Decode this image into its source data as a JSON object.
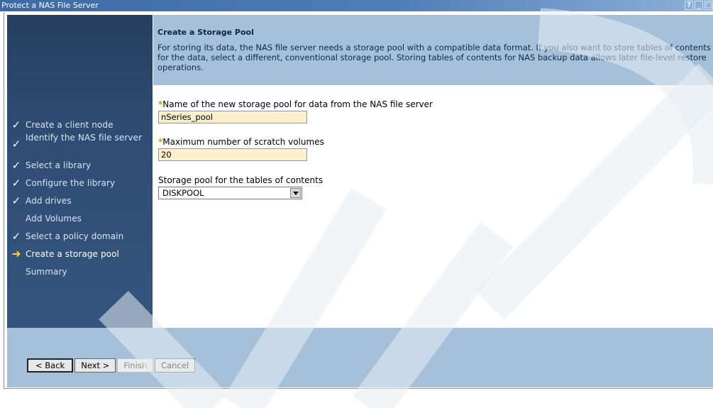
{
  "window": {
    "title": "Protect a NAS File Server",
    "controls": [
      "?",
      "_",
      "□"
    ]
  },
  "sidebar": {
    "steps": [
      {
        "label": "Create a client node",
        "status": "done"
      },
      {
        "label": "Identify the NAS file server",
        "status": "done"
      },
      {
        "label": "Select a library",
        "status": "done"
      },
      {
        "label": "Configure the library",
        "status": "done"
      },
      {
        "label": "Add drives",
        "status": "done"
      },
      {
        "label": "Add Volumes",
        "status": "none"
      },
      {
        "label": "Select a policy domain",
        "status": "done"
      },
      {
        "label": "Create a storage pool",
        "status": "current"
      },
      {
        "label": "Summary",
        "status": "none"
      }
    ]
  },
  "header": {
    "title": "Create a Storage Pool",
    "description": "For storing its data, the NAS file server needs a storage pool with a compatible data format. If you also want to store tables of contents for the data, select a different, conventional storage pool. Storing tables of contents for NAS backup data allows later file-level restore operations."
  },
  "form": {
    "required_marker": "*",
    "pool_name": {
      "label": "Name of the new storage pool for data from the NAS file server",
      "value": "nSeries_pool"
    },
    "scratch": {
      "label": "Maximum number of scratch volumes",
      "value": "20"
    },
    "toc_pool": {
      "label": "Storage pool for the tables of contents",
      "selected": "DISKPOOL"
    }
  },
  "buttons": {
    "back": "< Back",
    "next": "Next >",
    "finish": "Finish",
    "cancel": "Cancel"
  },
  "colors": {
    "sidebar": "#2f4d74",
    "header": "#a7c0d9",
    "input_bg": "#fcf0cc",
    "current_arrow": "#ffcc33"
  }
}
